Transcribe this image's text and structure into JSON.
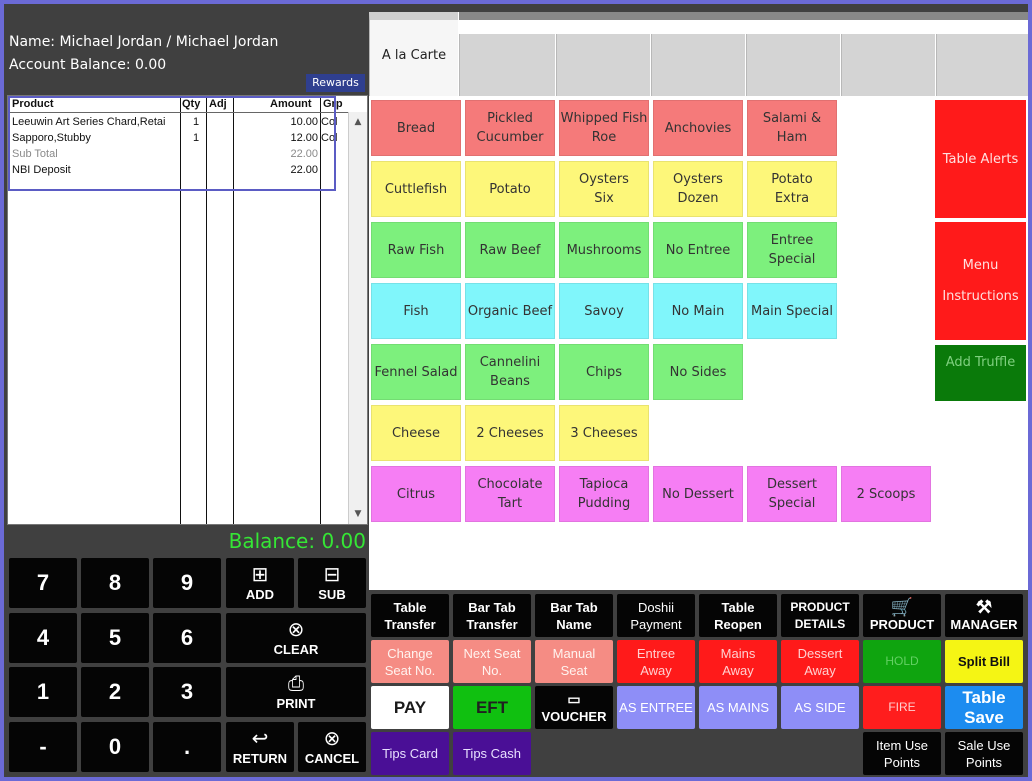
{
  "customer": {
    "name_line": "Name: Michael Jordan / Michael  Jordan",
    "account_balance": "Account Balance: 0.00",
    "rewards_label": "Rewards"
  },
  "order": {
    "columns": {
      "product": "Product",
      "qty": "Qty",
      "adj": "Adj",
      "amount": "Amount",
      "grp": "Grp"
    },
    "rows": [
      {
        "product": "Leeuwin Art Series Chard,Retai",
        "qty": "1",
        "amount": "10.00",
        "grp": "Col"
      },
      {
        "product": "Sapporo,Stubby",
        "qty": "1",
        "amount": "12.00",
        "grp": "Col"
      },
      {
        "product": "Sub Total",
        "qty": "",
        "amount": "22.00",
        "grp": ""
      },
      {
        "product": "NBI Deposit",
        "qty": "",
        "amount": "22.00",
        "grp": ""
      }
    ]
  },
  "balance": "Balance: 0.00",
  "keypad": {
    "k7": "7",
    "k8": "8",
    "k9": "9",
    "k4": "4",
    "k5": "5",
    "k6": "6",
    "k1": "1",
    "k2": "2",
    "k3": "3",
    "kminus": "-",
    "k0": "0",
    "kdot": ".",
    "add": "ADD",
    "sub": "SUB",
    "clear": "CLEAR",
    "print": "PRINT",
    "return": "RETURN",
    "cancel": "CANCEL"
  },
  "tabs": {
    "active": "A la Carte"
  },
  "menu": {
    "bread": "Bread",
    "pickled_cucumber": "Pickled\nCucumber",
    "whipped_fish_roe": "Whipped Fish\nRoe",
    "anchovies": "Anchovies",
    "salami_ham": "Salami &\nHam",
    "cuttlefish": "Cuttlefish",
    "potato": "Potato",
    "oysters_six": "Oysters\nSix",
    "oysters_dozen": "Oysters\nDozen",
    "potato_extra": "Potato\nExtra",
    "raw_fish": "Raw Fish",
    "raw_beef": "Raw Beef",
    "mushrooms": "Mushrooms",
    "no_entree": "No Entree",
    "entree_special": "Entree\nSpecial",
    "fish": "Fish",
    "organic_beef": "Organic Beef",
    "savoy": "Savoy",
    "no_main": "No Main",
    "main_special": "Main Special",
    "fennel_salad": "Fennel Salad",
    "cannelini_beans": "Cannelini\nBeans",
    "chips": "Chips",
    "no_sides": "No Sides",
    "cheese": "Cheese",
    "two_cheeses": "2 Cheeses",
    "three_cheeses": "3 Cheeses",
    "citrus": "Citrus",
    "chocolate_tart": "Chocolate\nTart",
    "tapioca_pudding": "Tapioca\nPudding",
    "no_dessert": "No Dessert",
    "dessert_special": "Dessert\nSpecial",
    "two_scoops": "2 Scoops"
  },
  "side": {
    "table_alerts": "Table Alerts",
    "menu_instructions": "Menu\nInstructions",
    "add_truffle": "Add Truffle"
  },
  "functions": {
    "table_transfer": "Table\nTransfer",
    "bar_tab_transfer": "Bar Tab\nTransfer",
    "bar_tab_name": "Bar Tab\nName",
    "doshii_payment": "Doshii\nPayment",
    "table_reopen": "Table\nReopen",
    "product_details": "PRODUCT\nDETAILS",
    "product": "PRODUCT",
    "manager": "MANAGER",
    "change_seat": "Change\nSeat No.",
    "next_seat": "Next Seat\nNo.",
    "manual_seat": "Manual\nSeat",
    "entree_away": "Entree\nAway",
    "mains_away": "Mains\nAway",
    "dessert_away": "Dessert\nAway",
    "hold": "HOLD",
    "split_bill": "Split Bill",
    "pay": "PAY",
    "eft": "EFT",
    "voucher": "VOUCHER",
    "as_entree": "AS ENTREE",
    "as_mains": "AS MAINS",
    "as_side": "AS SIDE",
    "fire": "FIRE",
    "table_save": "Table\nSave",
    "tips_card": "Tips Card",
    "tips_cash": "Tips Cash",
    "item_use_points": "Item Use\nPoints",
    "sale_use_points": "Sale Use\nPoints"
  },
  "colors": {
    "balance_text": "#35e635",
    "frame": "#6b6ad6",
    "red_item": "#f57a7a",
    "yellow_item": "#fdf77a",
    "green_item": "#7df07d",
    "cyan_item": "#80f6fb",
    "pink_item": "#f67ef4"
  }
}
